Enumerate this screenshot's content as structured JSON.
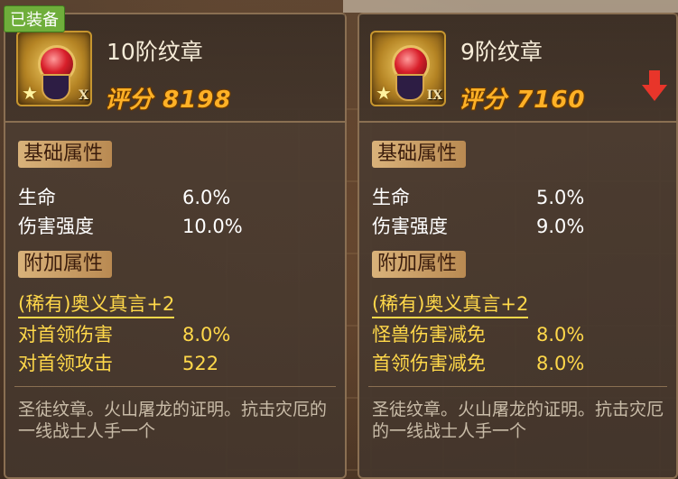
{
  "left": {
    "badge": "已装备",
    "name": "10阶纹章",
    "roman": "X",
    "score_label": "评分",
    "score_value": "8198",
    "basic_title": "基础属性",
    "basic": [
      {
        "label": "生命",
        "value": "6.0%"
      },
      {
        "label": "伤害强度",
        "value": "10.0%"
      }
    ],
    "extra_title": "附加属性",
    "rare": "(稀有)奥义真言+2",
    "extra": [
      {
        "label": "对首领伤害",
        "value": "8.0%"
      },
      {
        "label": "对首领攻击",
        "value": "522"
      }
    ],
    "description": "圣徒纹章。火山屠龙的证明。抗击灾厄的一线战士人手一个"
  },
  "right": {
    "name": "9阶纹章",
    "roman": "IX",
    "score_label": "评分",
    "score_value": "7160",
    "basic_title": "基础属性",
    "basic": [
      {
        "label": "生命",
        "value": "5.0%"
      },
      {
        "label": "伤害强度",
        "value": "9.0%"
      }
    ],
    "extra_title": "附加属性",
    "rare": "(稀有)奥义真言+2",
    "extra": [
      {
        "label": "怪兽伤害减免",
        "value": "8.0%"
      },
      {
        "label": "首领伤害减免",
        "value": "8.0%"
      }
    ],
    "description": "圣徒纹章。火山屠龙的证明。抗击灾厄的一线战士人手一个"
  },
  "icons": {
    "emblem": "emblem-icon",
    "star": "star-icon",
    "downgrade": "down-arrow-icon"
  },
  "colors": {
    "score": "#ffb126",
    "extra_text": "#ffd84a",
    "badge": "#6fae3b",
    "downgrade_arrow": "#e8352a"
  }
}
